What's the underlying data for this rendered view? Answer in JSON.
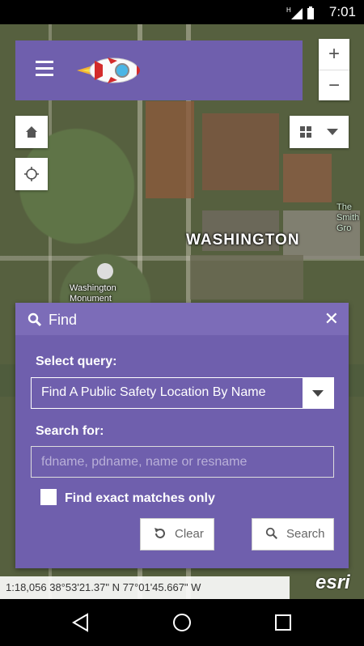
{
  "status_bar": {
    "time": "7:01"
  },
  "map": {
    "labels": {
      "city": "WASHINGTON",
      "monument": "Washington Monument",
      "smithsonian": "The Smith Gro"
    },
    "coordinates": "1:18,056  38°53'21.37\" N  77°01'45.667\" W",
    "attribution": "esri"
  },
  "zoom": {
    "in": "+",
    "out": "−"
  },
  "find_panel": {
    "title": "Find",
    "select_query_label": "Select query:",
    "selected_query": "Find A Public Safety Location By Name",
    "search_for_label": "Search for:",
    "search_placeholder": "fdname, pdname, name or resname",
    "exact_match_label": "Find exact matches only",
    "clear_label": "Clear",
    "search_label": "Search"
  },
  "colors": {
    "accent": "#6f5fad",
    "header": "#7c6cb8"
  }
}
